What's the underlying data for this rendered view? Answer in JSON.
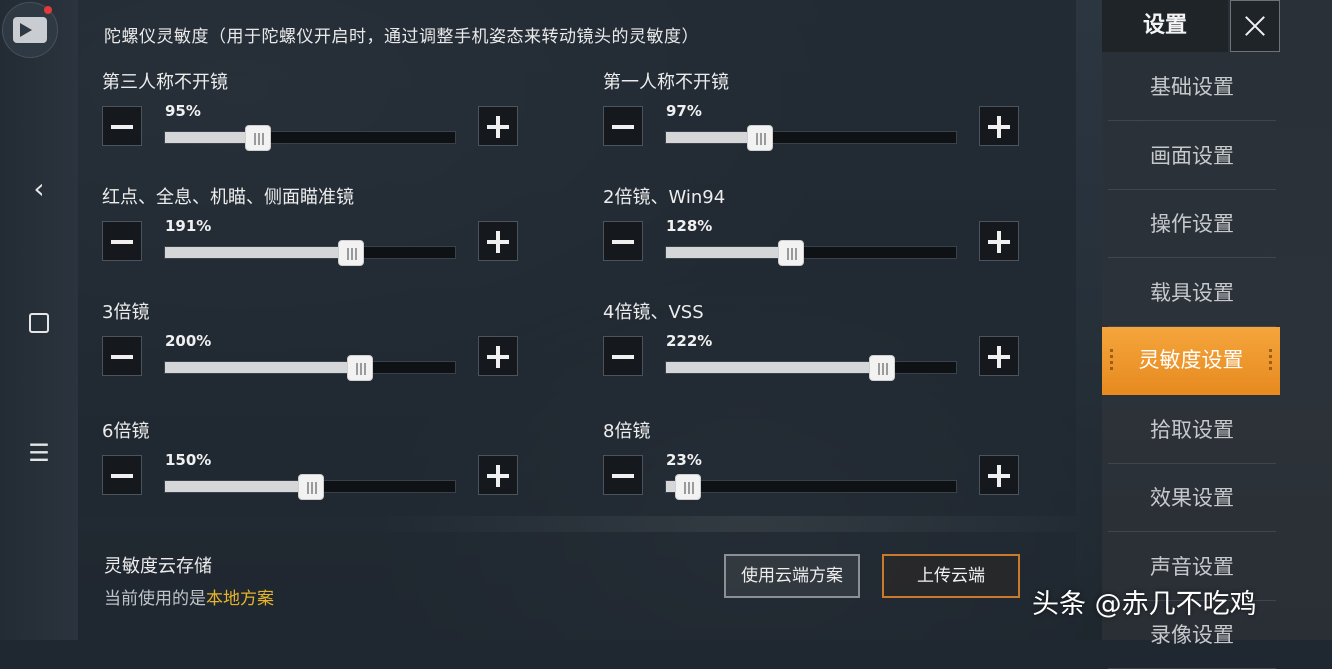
{
  "panel": {
    "title": "陀螺仪灵敏度（用于陀螺仪开启时，通过调整手机姿态来转动镜头的灵敏度）"
  },
  "sliders": [
    {
      "label": "第三人称不开镜",
      "value_text": "95%",
      "fraction": 0.317
    },
    {
      "label": "第一人称不开镜",
      "value_text": "97%",
      "fraction": 0.323
    },
    {
      "label": "红点、全息、机瞄、侧面瞄准镜",
      "value_text": "191%",
      "fraction": 0.637
    },
    {
      "label": "2倍镜、Win94",
      "value_text": "128%",
      "fraction": 0.427
    },
    {
      "label": "3倍镜",
      "value_text": "200%",
      "fraction": 0.667
    },
    {
      "label": "4倍镜、VSS",
      "value_text": "222%",
      "fraction": 0.74
    },
    {
      "label": "6倍镜",
      "value_text": "150%",
      "fraction": 0.5
    },
    {
      "label": "8倍镜",
      "value_text": "23%",
      "fraction": 0.077
    }
  ],
  "cloud": {
    "title": "灵敏度云存储",
    "current_prefix": "当前使用的是",
    "current_value": "本地方案",
    "use_button": "使用云端方案",
    "upload_button": "上传云端"
  },
  "menu": {
    "title": "设置",
    "items": [
      "基础设置",
      "画面设置",
      "操作设置",
      "载具设置",
      "灵敏度设置",
      "拾取设置",
      "效果设置",
      "声音设置",
      "录像设置"
    ],
    "active_index": 4
  },
  "watermark": "头条 @赤几不吃鸡",
  "colors": {
    "accent": "#e78a1f",
    "highlight_text": "#e6b32c"
  }
}
